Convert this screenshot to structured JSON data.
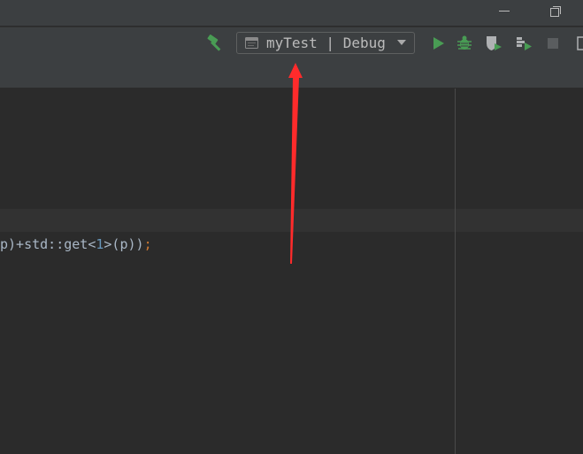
{
  "toolbar": {
    "run_config": {
      "name": "myTest",
      "separator": " | ",
      "profile": "Debug",
      "display": "myTest | Debug"
    },
    "icons": [
      "build-hammer-icon",
      "run-icon",
      "debug-icon",
      "coverage-icon",
      "profile-icon",
      "stop-icon"
    ]
  },
  "editor": {
    "code_line": {
      "part1": "p)+std::get<",
      "num": "1",
      "part2": ">(p))",
      "semicolon": ";"
    }
  },
  "annotation": {
    "type": "red-arrow",
    "color": "#ff2b2b"
  },
  "colors": {
    "background": "#2b2b2b",
    "panel": "#3c3f41",
    "text": "#a9b7c6",
    "number": "#6897bb",
    "keyword": "#cc7832",
    "run_green": "#499c54"
  }
}
